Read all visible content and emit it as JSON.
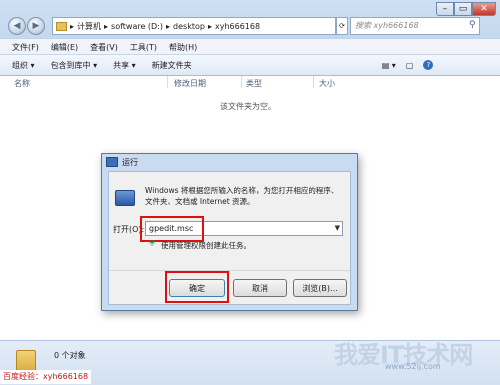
{
  "window": {
    "address_parts": [
      "计算机",
      "software (D:)",
      "desktop",
      "xyh666168"
    ],
    "search_placeholder": "搜索 xyh666168"
  },
  "menu": [
    "文件(F)",
    "编辑(E)",
    "查看(V)",
    "工具(T)",
    "帮助(H)"
  ],
  "toolbar": {
    "organize": "组织 ▾",
    "include": "包含到库中 ▾",
    "share": "共享 ▾",
    "new_folder": "新建文件夹"
  },
  "columns": [
    "名称",
    "修改日期",
    "类型",
    "大小"
  ],
  "empty_message": "该文件夹为空。",
  "run_dialog": {
    "title": "运行",
    "description_line1": "Windows 将根据您所输入的名称，为您打开相应的程序、",
    "description_line2": "文件夹、文档或 Internet 资源。",
    "open_label": "打开(O):",
    "input_value": "gpedit.msc",
    "admin_note": "使用管理权限创建此任务。",
    "ok_label": "确定",
    "cancel_label": "取消",
    "browse_label": "浏览(B)..."
  },
  "status": {
    "count": "0 个对象"
  },
  "watermark": {
    "title": "我爱IT技术网",
    "url": "www.52ij.com"
  },
  "caption": "百度经验：xyh666168"
}
